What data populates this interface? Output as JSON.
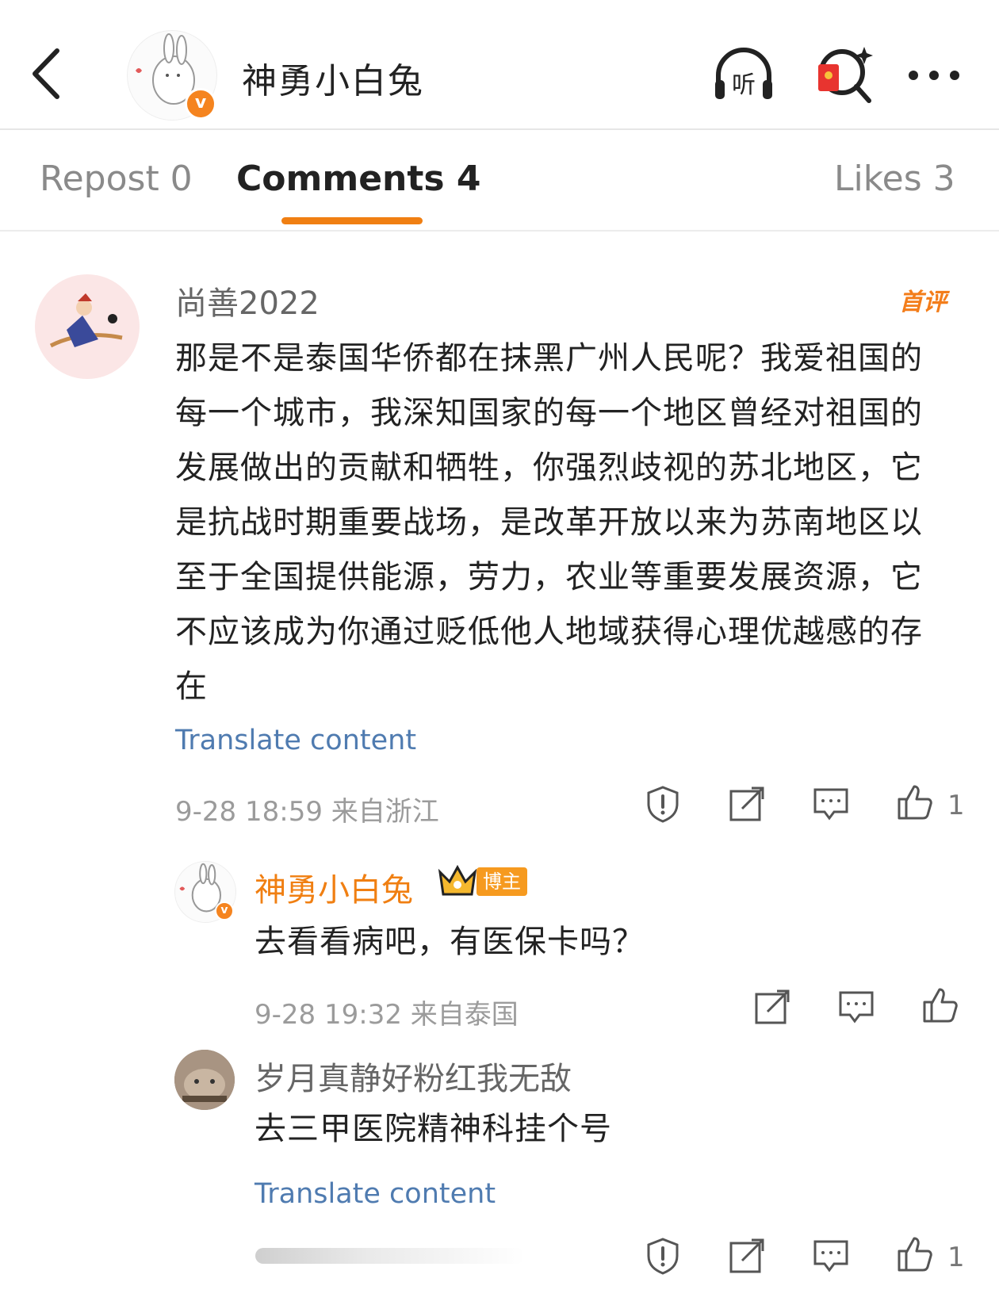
{
  "header": {
    "title": "神勇小白兔",
    "listen_label": "听",
    "verified_mark": "v"
  },
  "tabs": {
    "repost": "Repost 0",
    "comments": "Comments 4",
    "likes": "Likes 3"
  },
  "comments": [
    {
      "username": "尚善2022",
      "badge": "首评",
      "text": "那是不是泰国华侨都在抹黑广州人民呢？我爱祖国的每一个城市，我深知国家的每一个地区曾经对祖国的发展做出的贡献和牺牲，你强烈歧视的苏北地区，它是抗战时期重要战场，是改革开放以来为苏南地区以至于全国提供能源，劳力，农业等重要发展资源，它不应该成为你通过贬低他人地域获得心理优越感的存在",
      "translate": "Translate content",
      "time_location": "9-28 18:59  来自浙江",
      "like_count": "1"
    },
    {
      "username": "神勇小白兔",
      "role_badge": "博主",
      "text": "去看看病吧，有医保卡吗？",
      "time_location": "9-28 19:32  来自泰国"
    },
    {
      "username": "岁月真静好粉红我无敌",
      "text": "去三甲医院精神科挂个号",
      "translate": "Translate content",
      "like_count": "1"
    }
  ],
  "colors": {
    "accent": "#f07f12",
    "link": "#4f7bb0",
    "muted": "#9b9b9b"
  }
}
